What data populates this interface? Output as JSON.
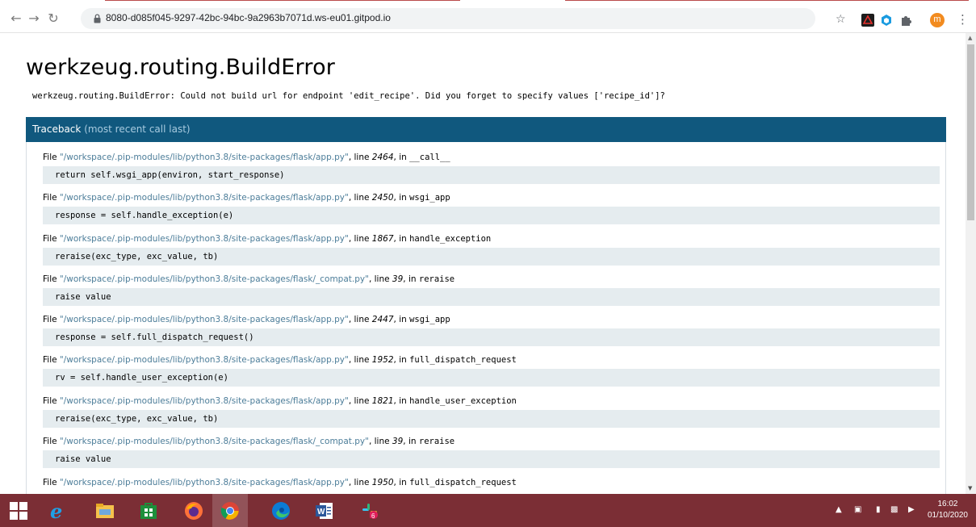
{
  "browser": {
    "url": "8080-d085f045-9297-42bc-94bc-9a2963b7071d.ws-eu01.gitpod.io",
    "avatar_letter": "m"
  },
  "page": {
    "title": "werkzeug.routing.BuildError",
    "message": "werkzeug.routing.BuildError: Could not build url for endpoint 'edit_recipe'. Did you forget to specify values ['recipe_id']?",
    "traceback_title": "Traceback",
    "traceback_subtitle": "(most recent call last)",
    "file_prefix": "File ",
    "line_label": ", line ",
    "in_label": ", in ",
    "frames": [
      {
        "file": "\"/workspace/.pip-modules/lib/python3.8/site-packages/flask/app.py\"",
        "line": "2464",
        "func": "__call__",
        "code": "return self.wsgi_app(environ, start_response)"
      },
      {
        "file": "\"/workspace/.pip-modules/lib/python3.8/site-packages/flask/app.py\"",
        "line": "2450",
        "func": "wsgi_app",
        "code": "response = self.handle_exception(e)"
      },
      {
        "file": "\"/workspace/.pip-modules/lib/python3.8/site-packages/flask/app.py\"",
        "line": "1867",
        "func": "handle_exception",
        "code": "reraise(exc_type, exc_value, tb)"
      },
      {
        "file": "\"/workspace/.pip-modules/lib/python3.8/site-packages/flask/_compat.py\"",
        "line": "39",
        "func": "reraise",
        "code": "raise value"
      },
      {
        "file": "\"/workspace/.pip-modules/lib/python3.8/site-packages/flask/app.py\"",
        "line": "2447",
        "func": "wsgi_app",
        "code": "response = self.full_dispatch_request()"
      },
      {
        "file": "\"/workspace/.pip-modules/lib/python3.8/site-packages/flask/app.py\"",
        "line": "1952",
        "func": "full_dispatch_request",
        "code": "rv = self.handle_user_exception(e)"
      },
      {
        "file": "\"/workspace/.pip-modules/lib/python3.8/site-packages/flask/app.py\"",
        "line": "1821",
        "func": "handle_user_exception",
        "code": "reraise(exc_type, exc_value, tb)"
      },
      {
        "file": "\"/workspace/.pip-modules/lib/python3.8/site-packages/flask/_compat.py\"",
        "line": "39",
        "func": "reraise",
        "code": "raise value"
      },
      {
        "file": "\"/workspace/.pip-modules/lib/python3.8/site-packages/flask/app.py\"",
        "line": "1950",
        "func": "full_dispatch_request",
        "code": ""
      }
    ]
  },
  "taskbar": {
    "apps": [
      "start-icon",
      "edge-legacy-icon",
      "file-explorer-icon",
      "store-icon",
      "firefox-icon",
      "chrome-icon",
      "edge-icon",
      "word-icon",
      "slack-icon"
    ],
    "slack_badge": "6",
    "time": "16:02",
    "date": "01/10/2020"
  },
  "colors": {
    "traceback_header": "#10587e",
    "code_bg": "#e5ecef",
    "filename": "#4c7d99",
    "taskbar": "#7b2e35"
  }
}
